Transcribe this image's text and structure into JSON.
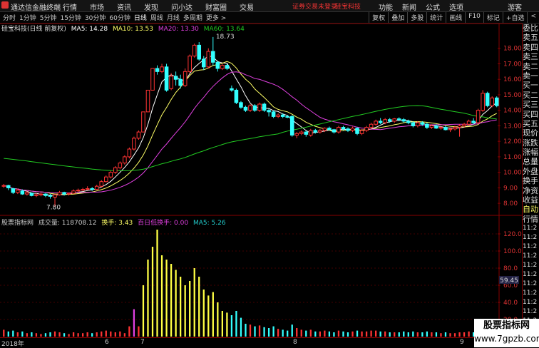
{
  "topbar": {
    "app_name": "通达信金融终端",
    "menu": [
      "行情",
      "市场",
      "资讯",
      "发现",
      "问小达",
      "财富圈",
      "交易"
    ],
    "notice": "证券交易未登录",
    "stock_name": "硅宝科技",
    "right_menu": [
      "功能",
      "新闻",
      "公式",
      "选项"
    ],
    "guest": "游客"
  },
  "timeframes": {
    "tabs": [
      "分时",
      "1分钟",
      "5分钟",
      "15分钟",
      "30分钟",
      "60分钟",
      "日线",
      "周线",
      "月线",
      "多周期",
      "更多 >"
    ],
    "active": "日线",
    "tools": [
      "复权",
      "叠加",
      "多股",
      "统计",
      "画线",
      "F10",
      "标记",
      "+自选",
      "<"
    ]
  },
  "ma_legend": {
    "title": "硅宝科技(日线 前复权)",
    "ma5": "MA5: 14.28",
    "ma10": "MA10: 13.53",
    "ma20": "MA20: 13.30",
    "ma60": "MA60: 13.64",
    "colors": {
      "ma5": "#ffffff",
      "ma10": "#ffff66",
      "ma20": "#e040e0",
      "ma60": "#22cc22"
    }
  },
  "volume_legend": {
    "title": "股票指标网",
    "vol": "成交量: 118708.12",
    "turnover": "换手: 3.43",
    "low_turnover": "百日低换手: 0.00",
    "ma5": "MA5: 5.26"
  },
  "price_axis": [
    "18.00",
    "17.00",
    "16.00",
    "15.00",
    "14.00",
    "13.00",
    "12.00",
    "11.00",
    "10.00",
    "9.00",
    "8.00"
  ],
  "volume_axis": [
    "120.0",
    "100.0",
    "80.0",
    "60.0",
    "40.0",
    "20.0"
  ],
  "vol_current_value": "59.45",
  "annotations": {
    "high": "18.73",
    "low": "7.80"
  },
  "right_panel": {
    "quote_labels": [
      "委比",
      "卖五",
      "卖四",
      "卖三",
      "卖二",
      "卖一",
      "买一",
      "买二",
      "买三",
      "买四",
      "买五",
      "现价",
      "涨跌",
      "涨幅",
      "总量",
      "外盘",
      "换手",
      "净资",
      "收益"
    ],
    "tab_labels": [
      "自动",
      "行情"
    ],
    "times": [
      "11:2",
      "11:2",
      "11:2",
      "11:2",
      "11:2",
      "11:2",
      "11:2",
      "11:2",
      "11:2",
      "11:2",
      "11:2",
      "11:2",
      "11:2",
      "11:2",
      "11:3"
    ]
  },
  "bottom_axis": {
    "year": "2018年",
    "months": [
      "6",
      "7",
      "8",
      "9"
    ]
  },
  "watermark": {
    "line1": "股票指标网",
    "line2": "www.7gpzb.com"
  },
  "chart_data": {
    "type": "candlestick",
    "price_ylim": [
      7.5,
      19
    ],
    "volume_ylim": [
      0,
      130
    ],
    "candles": [
      {
        "o": 9.1,
        "c": 9.15,
        "h": 9.25,
        "l": 9.0,
        "v": 8
      },
      {
        "o": 9.15,
        "c": 9.0,
        "h": 9.2,
        "l": 8.85,
        "v": 6
      },
      {
        "o": 8.95,
        "c": 8.7,
        "h": 9.0,
        "l": 8.6,
        "v": 7
      },
      {
        "o": 8.7,
        "c": 8.85,
        "h": 8.95,
        "l": 8.6,
        "v": 5
      },
      {
        "o": 8.8,
        "c": 8.6,
        "h": 8.9,
        "l": 8.55,
        "v": 6
      },
      {
        "o": 8.6,
        "c": 8.7,
        "h": 8.8,
        "l": 8.5,
        "v": 4
      },
      {
        "o": 8.65,
        "c": 8.5,
        "h": 8.7,
        "l": 8.45,
        "v": 5
      },
      {
        "o": 8.5,
        "c": 8.55,
        "h": 8.65,
        "l": 8.4,
        "v": 4
      },
      {
        "o": 8.55,
        "c": 8.6,
        "h": 8.7,
        "l": 8.45,
        "v": 3
      },
      {
        "o": 8.6,
        "c": 8.5,
        "h": 8.65,
        "l": 8.4,
        "v": 4
      },
      {
        "o": 8.5,
        "c": 8.45,
        "h": 8.6,
        "l": 8.3,
        "v": 5
      },
      {
        "o": 8.4,
        "c": 8.55,
        "h": 8.6,
        "l": 7.8,
        "v": 6
      },
      {
        "o": 8.55,
        "c": 8.7,
        "h": 8.8,
        "l": 8.5,
        "v": 5
      },
      {
        "o": 8.7,
        "c": 8.6,
        "h": 8.75,
        "l": 8.5,
        "v": 4
      },
      {
        "o": 8.6,
        "c": 8.65,
        "h": 8.7,
        "l": 8.5,
        "v": 3
      },
      {
        "o": 8.65,
        "c": 8.8,
        "h": 8.9,
        "l": 8.6,
        "v": 5
      },
      {
        "o": 8.8,
        "c": 8.85,
        "h": 8.95,
        "l": 8.7,
        "v": 4
      },
      {
        "o": 8.85,
        "c": 8.9,
        "h": 9.0,
        "l": 8.8,
        "v": 4
      },
      {
        "o": 8.9,
        "c": 8.95,
        "h": 9.1,
        "l": 8.85,
        "v": 5
      },
      {
        "o": 8.95,
        "c": 8.9,
        "h": 9.05,
        "l": 8.8,
        "v": 4
      },
      {
        "o": 8.9,
        "c": 9.1,
        "h": 9.2,
        "l": 8.85,
        "v": 5
      },
      {
        "o": 9.1,
        "c": 9.4,
        "h": 9.5,
        "l": 9.05,
        "v": 6
      },
      {
        "o": 9.4,
        "c": 9.7,
        "h": 9.8,
        "l": 9.35,
        "v": 7
      },
      {
        "o": 9.7,
        "c": 10.0,
        "h": 10.1,
        "l": 9.6,
        "v": 6
      },
      {
        "o": 10.0,
        "c": 10.3,
        "h": 10.4,
        "l": 9.9,
        "v": 5
      },
      {
        "o": 10.3,
        "c": 10.6,
        "h": 10.7,
        "l": 10.2,
        "v": 6
      },
      {
        "o": 10.6,
        "c": 11.0,
        "h": 11.1,
        "l": 10.5,
        "v": 4
      },
      {
        "o": 11.0,
        "c": 11.5,
        "h": 11.6,
        "l": 10.9,
        "v": 12
      },
      {
        "o": 11.5,
        "c": 12.2,
        "h": 12.3,
        "l": 11.4,
        "v": 32
      },
      {
        "o": 12.2,
        "c": 12.6,
        "h": 12.7,
        "l": 12.1,
        "v": 12
      },
      {
        "o": 12.6,
        "c": 13.9,
        "h": 13.9,
        "l": 12.6,
        "v": 60
      },
      {
        "o": 13.9,
        "c": 15.3,
        "h": 15.3,
        "l": 13.9,
        "v": 90
      },
      {
        "o": 15.3,
        "c": 16.7,
        "h": 16.7,
        "l": 15.3,
        "v": 105
      },
      {
        "o": 16.7,
        "c": 16.5,
        "h": 16.9,
        "l": 16.3,
        "v": 125
      },
      {
        "o": 16.5,
        "c": 16.8,
        "h": 17.0,
        "l": 16.4,
        "v": 95
      },
      {
        "o": 16.8,
        "c": 15.3,
        "h": 17.0,
        "l": 15.2,
        "v": 90
      },
      {
        "o": 15.4,
        "c": 16.2,
        "h": 16.4,
        "l": 15.3,
        "v": 85
      },
      {
        "o": 16.2,
        "c": 16.0,
        "h": 16.5,
        "l": 15.6,
        "v": 78
      },
      {
        "o": 16.0,
        "c": 15.6,
        "h": 16.3,
        "l": 15.4,
        "v": 70
      },
      {
        "o": 15.6,
        "c": 16.5,
        "h": 16.7,
        "l": 15.5,
        "v": 60
      },
      {
        "o": 16.5,
        "c": 17.5,
        "h": 17.6,
        "l": 16.4,
        "v": 65
      },
      {
        "o": 17.5,
        "c": 18.2,
        "h": 18.3,
        "l": 17.4,
        "v": 80
      },
      {
        "o": 18.2,
        "c": 17.3,
        "h": 18.4,
        "l": 17.2,
        "v": 70
      },
      {
        "o": 17.3,
        "c": 16.8,
        "h": 17.5,
        "l": 16.6,
        "v": 55
      },
      {
        "o": 16.8,
        "c": 17.8,
        "h": 18.0,
        "l": 16.7,
        "v": 48
      },
      {
        "o": 17.8,
        "c": 17.1,
        "h": 18.73,
        "l": 16.9,
        "v": 52
      },
      {
        "o": 17.1,
        "c": 16.7,
        "h": 17.2,
        "l": 16.5,
        "v": 40
      },
      {
        "o": 16.7,
        "c": 16.9,
        "h": 17.0,
        "l": 16.6,
        "v": 30
      },
      {
        "o": 16.9,
        "c": 16.7,
        "h": 17.0,
        "l": 16.6,
        "v": 28
      },
      {
        "o": 15.4,
        "c": 15.3,
        "h": 15.6,
        "l": 15.2,
        "v": 25
      },
      {
        "o": 15.3,
        "c": 14.5,
        "h": 15.4,
        "l": 14.4,
        "v": 30
      },
      {
        "o": 14.5,
        "c": 14.2,
        "h": 14.6,
        "l": 14.1,
        "v": 22
      },
      {
        "o": 14.2,
        "c": 14.0,
        "h": 14.3,
        "l": 13.9,
        "v": 15
      },
      {
        "o": 14.0,
        "c": 14.3,
        "h": 14.4,
        "l": 13.9,
        "v": 14
      },
      {
        "o": 14.3,
        "c": 14.0,
        "h": 14.4,
        "l": 13.9,
        "v": 12
      },
      {
        "o": 14.0,
        "c": 14.4,
        "h": 14.5,
        "l": 13.9,
        "v": 13
      },
      {
        "o": 14.4,
        "c": 14.0,
        "h": 14.5,
        "l": 13.9,
        "v": 11
      },
      {
        "o": 14.0,
        "c": 13.9,
        "h": 14.1,
        "l": 13.6,
        "v": 10
      },
      {
        "o": 13.9,
        "c": 13.6,
        "h": 14.0,
        "l": 13.5,
        "v": 12
      },
      {
        "o": 13.6,
        "c": 13.7,
        "h": 13.8,
        "l": 13.5,
        "v": 9
      },
      {
        "o": 13.7,
        "c": 13.6,
        "h": 13.8,
        "l": 13.5,
        "v": 8
      },
      {
        "o": 13.6,
        "c": 13.55,
        "h": 13.7,
        "l": 13.5,
        "v": 7
      },
      {
        "o": 13.6,
        "c": 12.4,
        "h": 13.7,
        "l": 12.3,
        "v": 14
      },
      {
        "o": 12.4,
        "c": 12.5,
        "h": 12.6,
        "l": 12.2,
        "v": 10
      },
      {
        "o": 12.5,
        "c": 12.6,
        "h": 12.7,
        "l": 12.4,
        "v": 8
      },
      {
        "o": 12.6,
        "c": 12.45,
        "h": 12.7,
        "l": 12.3,
        "v": 7
      },
      {
        "o": 12.4,
        "c": 12.7,
        "h": 12.8,
        "l": 12.3,
        "v": 8
      },
      {
        "o": 12.7,
        "c": 12.6,
        "h": 12.8,
        "l": 12.5,
        "v": 6
      },
      {
        "o": 12.6,
        "c": 12.7,
        "h": 12.8,
        "l": 12.5,
        "v": 6
      },
      {
        "o": 12.7,
        "c": 12.85,
        "h": 12.9,
        "l": 12.6,
        "v": 7
      },
      {
        "o": 12.85,
        "c": 12.75,
        "h": 12.95,
        "l": 12.7,
        "v": 6
      },
      {
        "o": 12.75,
        "c": 12.6,
        "h": 12.8,
        "l": 12.5,
        "v": 5
      },
      {
        "o": 12.6,
        "c": 12.9,
        "h": 13.0,
        "l": 12.5,
        "v": 7
      },
      {
        "o": 12.9,
        "c": 12.8,
        "h": 13.0,
        "l": 12.7,
        "v": 6
      },
      {
        "o": 12.8,
        "c": 12.7,
        "h": 12.9,
        "l": 12.6,
        "v": 5
      },
      {
        "o": 12.7,
        "c": 12.85,
        "h": 12.95,
        "l": 12.6,
        "v": 6
      },
      {
        "o": 12.85,
        "c": 12.5,
        "h": 12.9,
        "l": 12.4,
        "v": 7
      },
      {
        "o": 12.5,
        "c": 12.7,
        "h": 12.8,
        "l": 12.4,
        "v": 6
      },
      {
        "o": 12.7,
        "c": 12.9,
        "h": 13.0,
        "l": 12.6,
        "v": 6
      },
      {
        "o": 12.9,
        "c": 13.1,
        "h": 13.2,
        "l": 12.8,
        "v": 7
      },
      {
        "o": 13.1,
        "c": 13.3,
        "h": 13.4,
        "l": 13.0,
        "v": 7
      },
      {
        "o": 13.3,
        "c": 13.2,
        "h": 13.5,
        "l": 13.1,
        "v": 6
      },
      {
        "o": 13.2,
        "c": 13.4,
        "h": 13.5,
        "l": 13.1,
        "v": 6
      },
      {
        "o": 13.4,
        "c": 13.3,
        "h": 13.5,
        "l": 13.2,
        "v": 5
      },
      {
        "o": 13.3,
        "c": 13.45,
        "h": 13.5,
        "l": 13.2,
        "v": 5
      },
      {
        "o": 13.45,
        "c": 13.4,
        "h": 13.55,
        "l": 13.3,
        "v": 5
      },
      {
        "o": 13.4,
        "c": 13.3,
        "h": 13.5,
        "l": 13.2,
        "v": 6
      },
      {
        "o": 13.3,
        "c": 13.2,
        "h": 13.4,
        "l": 13.1,
        "v": 5
      },
      {
        "o": 13.2,
        "c": 13.0,
        "h": 13.3,
        "l": 12.9,
        "v": 6
      },
      {
        "o": 13.0,
        "c": 13.2,
        "h": 13.3,
        "l": 12.9,
        "v": 5
      },
      {
        "o": 13.2,
        "c": 13.1,
        "h": 13.3,
        "l": 13.0,
        "v": 5
      },
      {
        "o": 13.1,
        "c": 12.9,
        "h": 13.2,
        "l": 12.8,
        "v": 6
      },
      {
        "o": 12.9,
        "c": 13.0,
        "h": 13.1,
        "l": 12.8,
        "v": 5
      },
      {
        "o": 13.0,
        "c": 12.85,
        "h": 13.1,
        "l": 12.8,
        "v": 5
      },
      {
        "o": 12.85,
        "c": 12.9,
        "h": 13.0,
        "l": 12.75,
        "v": 4
      },
      {
        "o": 12.9,
        "c": 12.75,
        "h": 13.0,
        "l": 12.7,
        "v": 5
      },
      {
        "o": 12.75,
        "c": 12.8,
        "h": 12.9,
        "l": 12.6,
        "v": 4
      },
      {
        "o": 12.8,
        "c": 12.9,
        "h": 13.0,
        "l": 12.7,
        "v": 4
      },
      {
        "o": 12.9,
        "c": 13.0,
        "h": 13.1,
        "l": 12.3,
        "v": 5
      },
      {
        "o": 13.0,
        "c": 13.1,
        "h": 13.2,
        "l": 12.9,
        "v": 5
      },
      {
        "o": 13.1,
        "c": 13.3,
        "h": 13.4,
        "l": 13.0,
        "v": 6
      },
      {
        "o": 13.3,
        "c": 13.2,
        "h": 13.5,
        "l": 13.1,
        "v": 5
      },
      {
        "o": 13.2,
        "c": 14.0,
        "h": 14.1,
        "l": 13.1,
        "v": 7
      },
      {
        "o": 14.0,
        "c": 15.1,
        "h": 15.3,
        "l": 13.9,
        "v": 9
      },
      {
        "o": 15.1,
        "c": 14.3,
        "h": 15.2,
        "l": 14.2,
        "v": 7
      },
      {
        "o": 14.3,
        "c": 14.8,
        "h": 14.9,
        "l": 14.2,
        "v": 6
      },
      {
        "o": 14.8,
        "c": 14.3,
        "h": 14.9,
        "l": 14.2,
        "v": 6
      }
    ],
    "ma_periods": [
      5,
      10,
      20,
      60
    ],
    "ma60_start": 10.9
  }
}
